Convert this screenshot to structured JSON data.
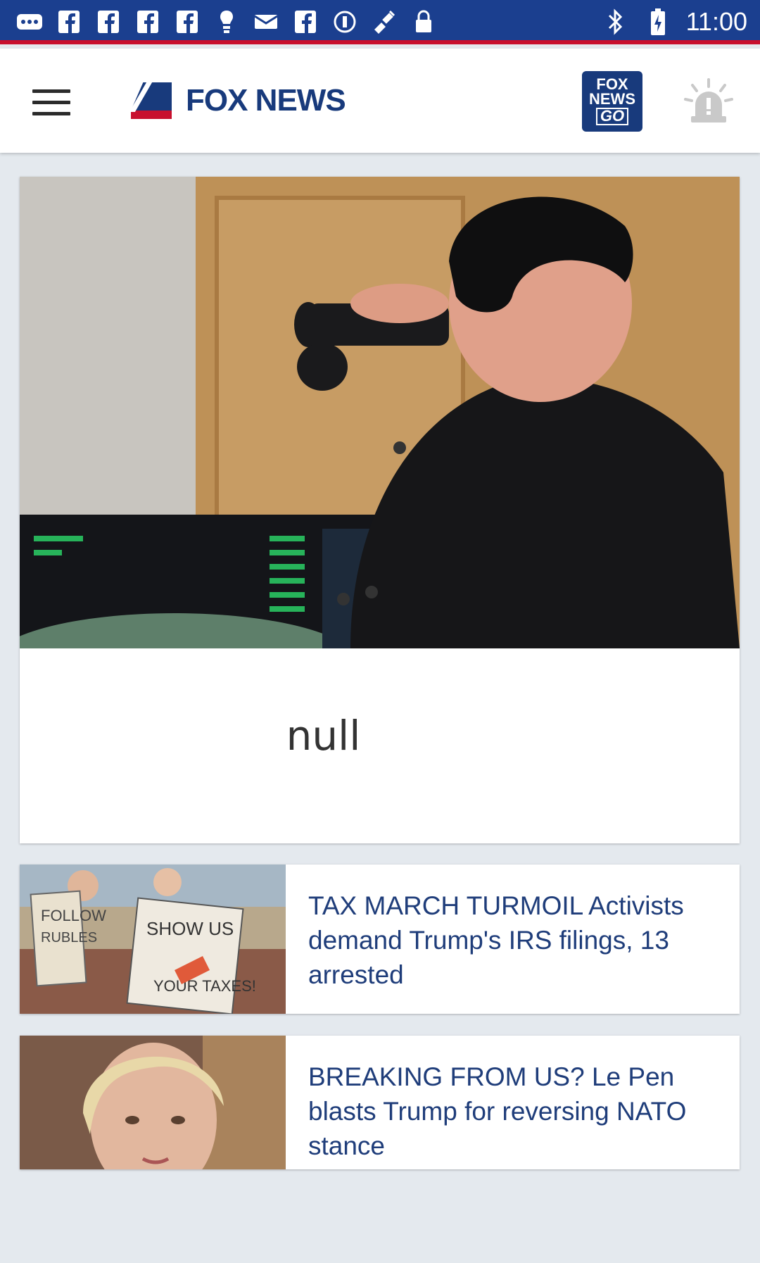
{
  "status_bar": {
    "time": "11:00",
    "icons": [
      "dots-icon",
      "facebook-icon",
      "facebook-icon",
      "facebook-icon",
      "facebook-icon",
      "bulb-icon",
      "mail-icon",
      "facebook-icon",
      "circle-icon",
      "satellite-icon",
      "lock-icon",
      "bluetooth-icon",
      "battery-icon"
    ]
  },
  "app_bar": {
    "brand": "FOX NEWS",
    "go_logo": {
      "line1": "FOX",
      "line2": "NEWS",
      "line3": "GO"
    },
    "colors": {
      "brand_blue": "#183a7c",
      "brand_red": "#c8102e"
    }
  },
  "hero": {
    "caption": "null"
  },
  "stories": [
    {
      "headline": "TAX MARCH TURMOIL Activists demand Trump's IRS filings, 13 arrested"
    },
    {
      "headline": "BREAKING FROM US? Le Pen blasts Trump for reversing NATO stance"
    }
  ]
}
